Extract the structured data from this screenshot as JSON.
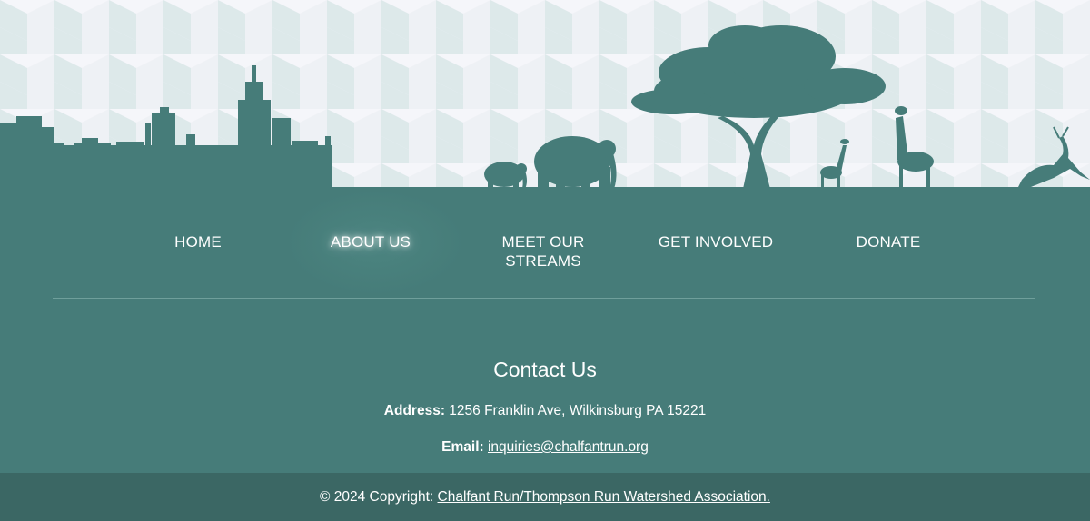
{
  "colors": {
    "primary": "#467c79",
    "footer": "#3b6764",
    "silhouette": "#467c79",
    "pattern_light": "#f6f6fb",
    "pattern_dark": "#dde9ea"
  },
  "nav": {
    "items": [
      {
        "label": "HOME"
      },
      {
        "label": "ABOUT US"
      },
      {
        "label": "MEET OUR STREAMS"
      },
      {
        "label": "GET INVOLVED"
      },
      {
        "label": "DONATE"
      }
    ],
    "active": "ABOUT US"
  },
  "contact": {
    "title": "Contact Us",
    "address_label": "Address:",
    "address_value": "1256 Franklin Ave, Wilkinsburg PA 15221",
    "email_label": "Email:",
    "email_value": "inquiries@chalfantrun.org"
  },
  "footer": {
    "copyright_prefix": "© 2024 Copyright:",
    "org_link": "Chalfant Run/Thompson Run Watershed Association."
  }
}
